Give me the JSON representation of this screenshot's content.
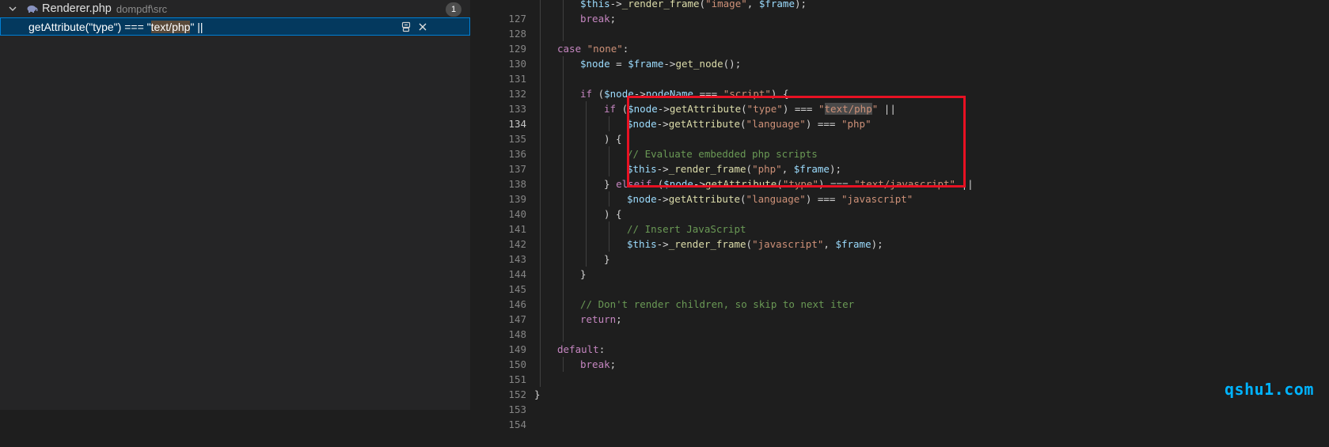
{
  "search_results": {
    "file_name": "Renderer.php",
    "file_path": "dompdf\\src",
    "match_count": "1",
    "match_before": "getAttribute(\"type\") === \"",
    "match_highlight": "text/php",
    "match_after": "\" ||"
  },
  "icons": {
    "expand": "chevron-down-icon",
    "file_type": "php-elephant-icon",
    "replace": "replace-icon",
    "dismiss": "close-icon"
  },
  "editor": {
    "active_line": "134",
    "lines": [
      {
        "n": "127"
      },
      {
        "n": "128"
      },
      {
        "n": "129"
      },
      {
        "n": "130"
      },
      {
        "n": "131"
      },
      {
        "n": "132"
      },
      {
        "n": "133"
      },
      {
        "n": "134"
      },
      {
        "n": "135"
      },
      {
        "n": "136"
      },
      {
        "n": "137"
      },
      {
        "n": "138"
      },
      {
        "n": "139"
      },
      {
        "n": "140"
      },
      {
        "n": "141"
      },
      {
        "n": "142"
      },
      {
        "n": "143"
      },
      {
        "n": "144"
      },
      {
        "n": "145"
      },
      {
        "n": "146"
      },
      {
        "n": "147"
      },
      {
        "n": "148"
      },
      {
        "n": "149"
      },
      {
        "n": "150"
      },
      {
        "n": "151"
      },
      {
        "n": "152"
      },
      {
        "n": "153"
      },
      {
        "n": "154"
      }
    ],
    "tokens": {
      "l127": [
        "$this",
        "->",
        "_render_frame",
        "(",
        "\"image\"",
        ", ",
        "$frame",
        ");"
      ],
      "l128": [
        "break",
        ";"
      ],
      "l130": [
        "case",
        " ",
        "\"none\"",
        ":"
      ],
      "l131": [
        "$node",
        " = ",
        "$frame",
        "->",
        "get_node",
        "();"
      ],
      "l133": [
        "if",
        " (",
        "$node",
        "->",
        "nodeName",
        " === ",
        "\"script\"",
        ") {"
      ],
      "l134": [
        "if",
        " (",
        "$node",
        "->",
        "getAttribute",
        "(",
        "\"type\"",
        ") === ",
        "\"",
        "text/php",
        "\"",
        " ||"
      ],
      "l135": [
        "$node",
        "->",
        "getAttribute",
        "(",
        "\"language\"",
        ") === ",
        "\"php\""
      ],
      "l136": [
        ") {"
      ],
      "l137": [
        "// Evaluate embedded php scripts"
      ],
      "l138": [
        "$this",
        "->",
        "_render_frame",
        "(",
        "\"php\"",
        ", ",
        "$frame",
        ");"
      ],
      "l139": [
        "} ",
        "elseif",
        " (",
        "$node",
        "->",
        "getAttribute",
        "(",
        "\"type\"",
        ") === ",
        "\"text/javascript\"",
        " ||"
      ],
      "l140": [
        "$node",
        "->",
        "getAttribute",
        "(",
        "\"language\"",
        ") === ",
        "\"javascript\""
      ],
      "l141": [
        ") {"
      ],
      "l142": [
        "// Insert JavaScript"
      ],
      "l143": [
        "$this",
        "->",
        "_render_frame",
        "(",
        "\"javascript\"",
        ", ",
        "$frame",
        ");"
      ],
      "l144": [
        "}"
      ],
      "l145": [
        "}"
      ],
      "l147": [
        "// Don't render children, so skip to next iter"
      ],
      "l148": [
        "return",
        ";"
      ],
      "l150": [
        "default",
        ":"
      ],
      "l151": [
        "break",
        ";"
      ],
      "l153": [
        "}"
      ]
    }
  },
  "watermark": "qshu1.com",
  "colors": {
    "keyword": "#c586c0",
    "variable": "#9cdcfe",
    "function": "#dcdcaa",
    "string": "#ce9178",
    "comment": "#6a9955",
    "annotation_box": "#e81123",
    "watermark": "#00b4ff"
  }
}
